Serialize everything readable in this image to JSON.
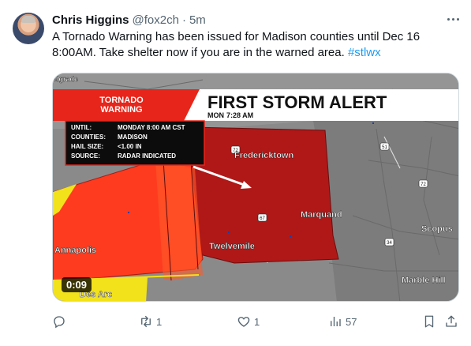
{
  "tweet": {
    "author_name": "Chris Higgins",
    "handle": "@fox2ch",
    "separator": "·",
    "time": "5m",
    "text": "A Tornado Warning has been issued for Madison counties until Dec 16 8:00AM. Take shelter now if you are in the warned area.",
    "hashtag": "#stlwx"
  },
  "media": {
    "video_time": "0:09",
    "banner_label_line1": "TORNADO",
    "banner_label_line2": "WARNING",
    "banner_title": "FIRST STORM ALERT",
    "banner_time_prefix": "MON",
    "banner_time": "7:28 AM",
    "info": {
      "until_label": "UNTIL:",
      "until_value": "MONDAY 8:00 AM CST",
      "counties_label": "COUNTIES:",
      "counties_value": "MADISON",
      "hail_label": "HAIL SIZE:",
      "hail_value": "<1.00 IN",
      "source_label": "SOURCE:",
      "source_value": "RADAR INDICATED"
    },
    "places": {
      "belgrade": "elgrade",
      "fredericktown": "Fredericktown",
      "marquand": "Marquand",
      "scopus": "Scopus",
      "twelvemile": "Twelvemile",
      "annapolis": "Annapolis",
      "marble_hill": "Marble Hill",
      "des_arc": "Des Arc"
    },
    "routes": [
      "72",
      "67",
      "34",
      "72",
      "51"
    ],
    "colors": {
      "warning_red": "#b01818",
      "watch_red": "#ff3b1f",
      "watch_yellow": "#f2e21c",
      "banner_red": "#e8251a"
    }
  },
  "actions": {
    "reply_count": "",
    "retweet_count": "1",
    "like_count": "1",
    "views_count": "57"
  }
}
